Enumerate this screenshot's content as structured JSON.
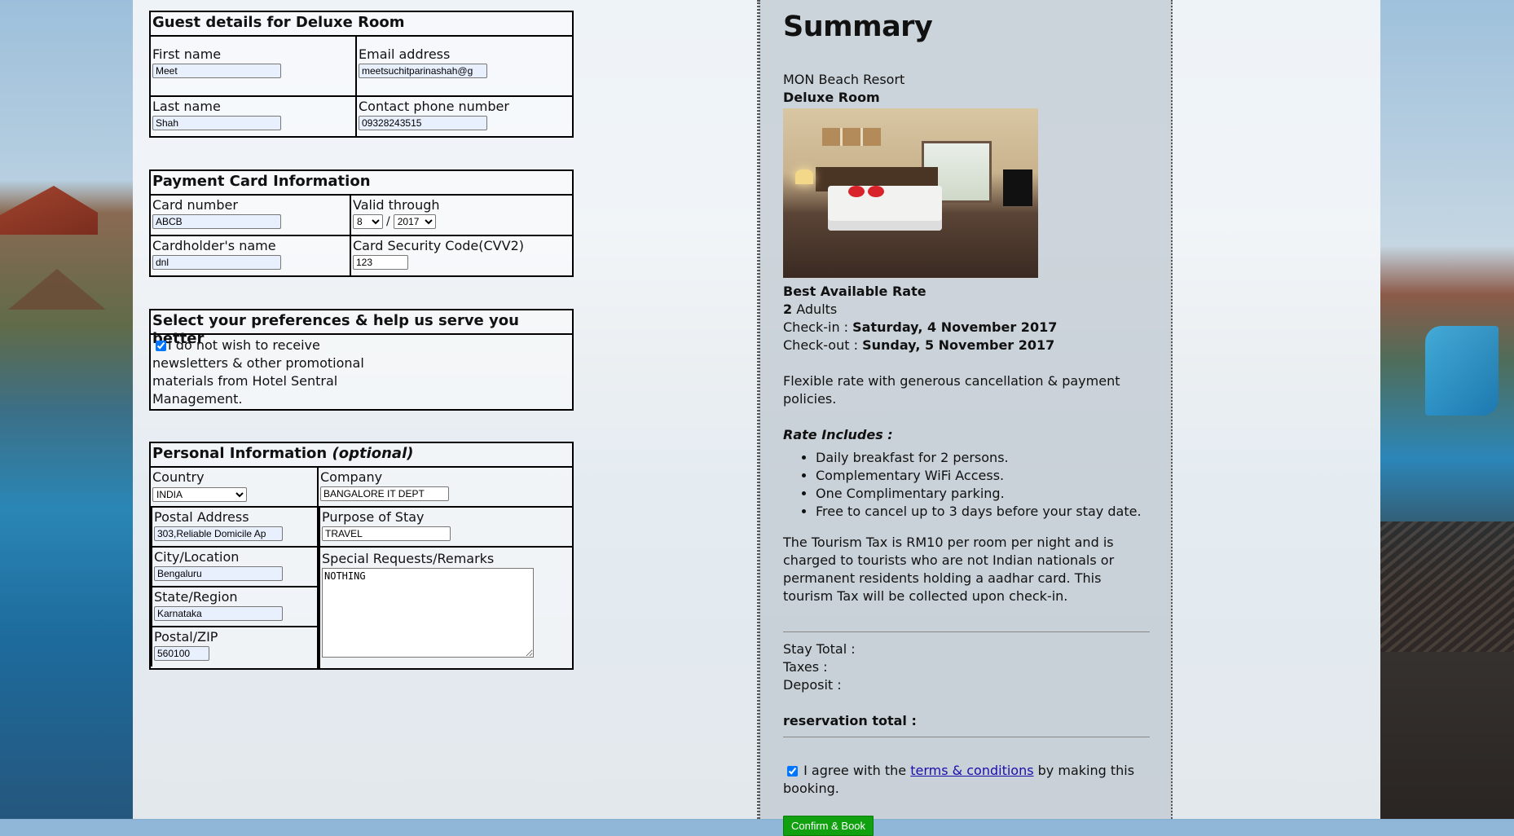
{
  "guest": {
    "title": "Guest details for Deluxe Room",
    "first_name_label": "First name",
    "first_name": "Meet",
    "email_label": "Email address",
    "email": "meetsuchitparinashah@g",
    "last_name_label": "Last name",
    "last_name": "Shah",
    "phone_label": "Contact phone number",
    "phone": "09328243515"
  },
  "payment": {
    "title": "Payment Card Information",
    "card_number_label": "Card number",
    "card_number": "ABCB",
    "valid_label": "Valid through",
    "valid_month": "8",
    "valid_separator": "/",
    "valid_year": "2017",
    "holder_label": "Cardholder's name",
    "holder": "dnl",
    "cvv_label": "Card Security Code(CVV2)",
    "cvv": "123"
  },
  "preferences": {
    "title": "Select your preferences & help us serve you better",
    "newsletter_line1": "I do not wish to receive",
    "newsletter_line2": "newsletters & other promotional",
    "newsletter_line3": "materials from Hotel Sentral",
    "newsletter_line4": "Management.",
    "newsletter_checked": true
  },
  "personal": {
    "title": "Personal Information",
    "title_optional": "(optional)",
    "country_label": "Country",
    "country": "INDIA",
    "company_label": "Company",
    "company": "BANGALORE IT DEPT",
    "address_label": "Postal Address",
    "address": "303,Reliable Domicile Ap",
    "purpose_label": "Purpose of Stay",
    "purpose": "TRAVEL",
    "city_label": "City/Location",
    "city": "Bengaluru",
    "remarks_label": "Special Requests/Remarks",
    "remarks": "NOTHING",
    "state_label": "State/Region",
    "state": "Karnataka",
    "zip_label": "Postal/ZIP",
    "zip": "560100"
  },
  "summary": {
    "heading": "Summary",
    "hotel": "MON Beach Resort",
    "room": "Deluxe Room",
    "rate_name": "Best Available Rate",
    "adults_count": "2",
    "adults_label": "Adults",
    "checkin_label": "Check-in :",
    "checkin_date": "Saturday, 4 November 2017",
    "checkout_label": "Check-out :",
    "checkout_date": "Sunday, 5 November 2017",
    "rate_desc": "Flexible rate with generous cancellation & payment policies.",
    "includes_title": "Rate Includes :",
    "includes": [
      "Daily breakfast for 2 persons.",
      "Complementary WiFi Access.",
      "One Complimentary parking.",
      "Free to cancel up to 3 days before your stay date."
    ],
    "tax_note": "The Tourism Tax is RM10 per room per night and is charged to tourists who are not Indian nationals or permanent residents holding a aadhar card. This tourism Tax will be collected upon check-in.",
    "stay_total_label": "Stay Total :",
    "taxes_label": "Taxes :",
    "deposit_label": "Deposit :",
    "reservation_total_label": "reservation total :",
    "agree_prefix": "I agree with the",
    "agree_link": "terms & conditions",
    "agree_suffix_1": "by making this",
    "agree_suffix_2": "booking.",
    "agree_checked": true,
    "confirm_button": "Confirm & Book"
  }
}
